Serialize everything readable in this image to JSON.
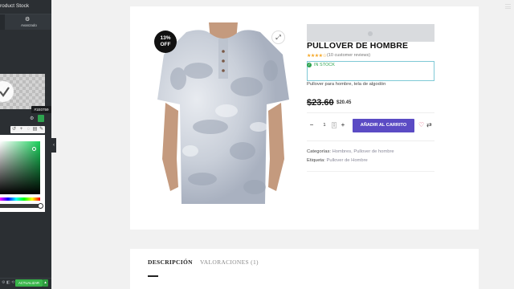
{
  "editor": {
    "title": "roduct Stock",
    "tab_label": "Avanzado",
    "hex_value": "#1E0759",
    "update_label": "ACTUALIZAR",
    "update_arrow": "▴",
    "footer_icons": "⚙ ◧ ⟲ ▣"
  },
  "product": {
    "sale_badge_pct": "13%",
    "sale_badge_off": "OFF",
    "title": "PULLOVER DE HOMBRE",
    "stars": "★★★★☆",
    "reviews": "(10 customer reviews)",
    "stock": "IN STOCK",
    "description": "Pullover para hombre, tela de algodón",
    "old_price": "$23.60",
    "new_price": "$20.45",
    "quantity": "1",
    "add_to_cart": "AÑADIR AL CARRITO",
    "categories_label": "Categorías:",
    "categories_value": "Hombres, Pullover de hombre",
    "tag_label": "Etiqueta:",
    "tag_value": "Pullover de Hombre"
  },
  "tabs": {
    "description": "DESCRIPCIÓN",
    "reviews": "VALORACIONES (1)"
  },
  "colors": {
    "accent_button": "#5b4bc4",
    "stock_green": "#2ea44f",
    "update_green": "#39b54a",
    "editor_bg": "#2b2f33"
  }
}
